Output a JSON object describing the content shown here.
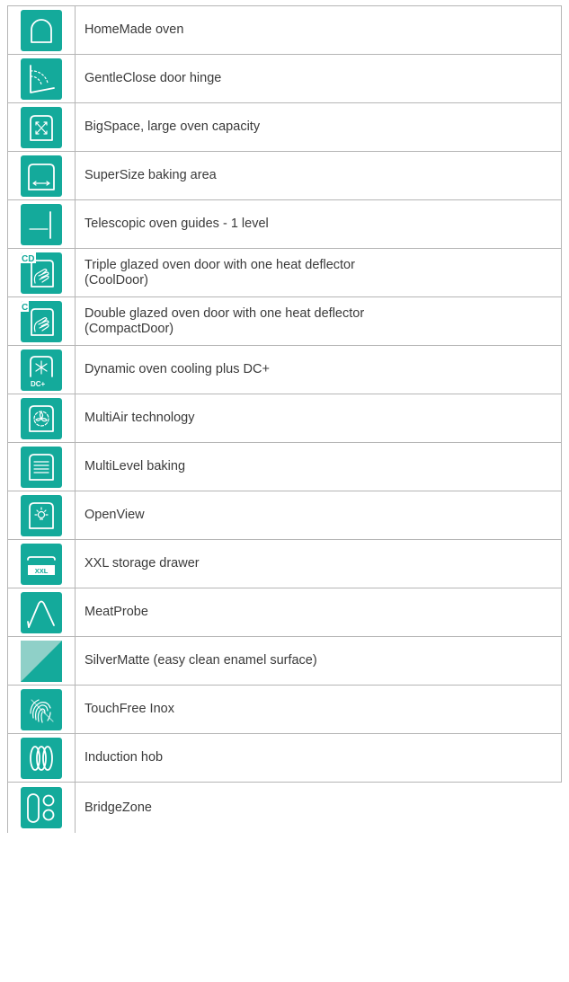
{
  "features": [
    {
      "label": "HomeMade oven",
      "icon": "homemade-oven-icon"
    },
    {
      "label": "GentleClose door hinge",
      "icon": "door-hinge-icon"
    },
    {
      "label": "BigSpace, large oven capacity",
      "icon": "bigspace-icon"
    },
    {
      "label": "SuperSize baking area",
      "icon": "supersize-icon"
    },
    {
      "label": "Telescopic oven guides - 1 level",
      "icon": "telescopic-guides-icon"
    },
    {
      "label": "Triple glazed oven door with one heat deflector\n(CoolDoor)",
      "icon": "cooldoor-icon",
      "badge": "CD"
    },
    {
      "label": "Double glazed oven door with one heat deflector\n(CompactDoor)",
      "icon": "compactdoor-icon",
      "badge": "C"
    },
    {
      "label": "Dynamic oven cooling plus DC+",
      "icon": "dynamic-cooling-icon",
      "badge": "DC+"
    },
    {
      "label": "MultiAir technology",
      "icon": "multiair-icon"
    },
    {
      "label": "MultiLevel baking",
      "icon": "multilevel-icon"
    },
    {
      "label": "OpenView",
      "icon": "openview-icon"
    },
    {
      "label": "XXL storage drawer",
      "icon": "xxl-drawer-icon",
      "badge": "XXL"
    },
    {
      "label": "MeatProbe",
      "icon": "meatprobe-icon"
    },
    {
      "label": "SilverMatte (easy clean enamel surface)",
      "icon": "silvermatte-icon"
    },
    {
      "label": "TouchFree Inox",
      "icon": "touchfree-inox-icon"
    },
    {
      "label": "Induction hob",
      "icon": "induction-hob-icon"
    },
    {
      "label": "BridgeZone",
      "icon": "bridgezone-icon"
    }
  ],
  "colors": {
    "accent": "#14aa9b",
    "border": "#b5b5b5",
    "text": "#3a3a3a"
  }
}
